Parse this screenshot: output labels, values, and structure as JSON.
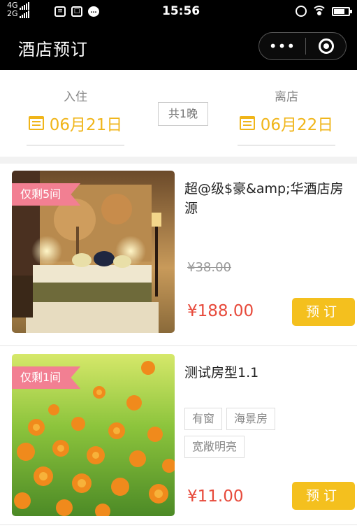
{
  "status_bar": {
    "network_top": "4G",
    "network_bottom": "2G",
    "time": "15:56",
    "battery_level": 0.7
  },
  "title_bar": {
    "title": "酒店预订",
    "more_glyph": "•••"
  },
  "dates": {
    "checkin_label": "入住",
    "checkin_date": "06月21日",
    "nights": "共1晚",
    "checkout_label": "离店",
    "checkout_date": "06月22日"
  },
  "rooms": [
    {
      "badge": "仅剩5间",
      "name": "超@级$豪&amp;华酒店房源",
      "old_price": "¥38.00",
      "price": "¥188.00",
      "book_label": "预订"
    },
    {
      "badge": "仅剩1间",
      "name": "测试房型1.1",
      "tags": [
        "有窗",
        "海景房",
        "宽敞明亮"
      ],
      "price": "¥11.00",
      "book_label": "预订"
    }
  ],
  "colors": {
    "accent": "#f4c01e",
    "date": "#f0b51a",
    "price": "#e74a3b",
    "badge": "#f27f92"
  }
}
